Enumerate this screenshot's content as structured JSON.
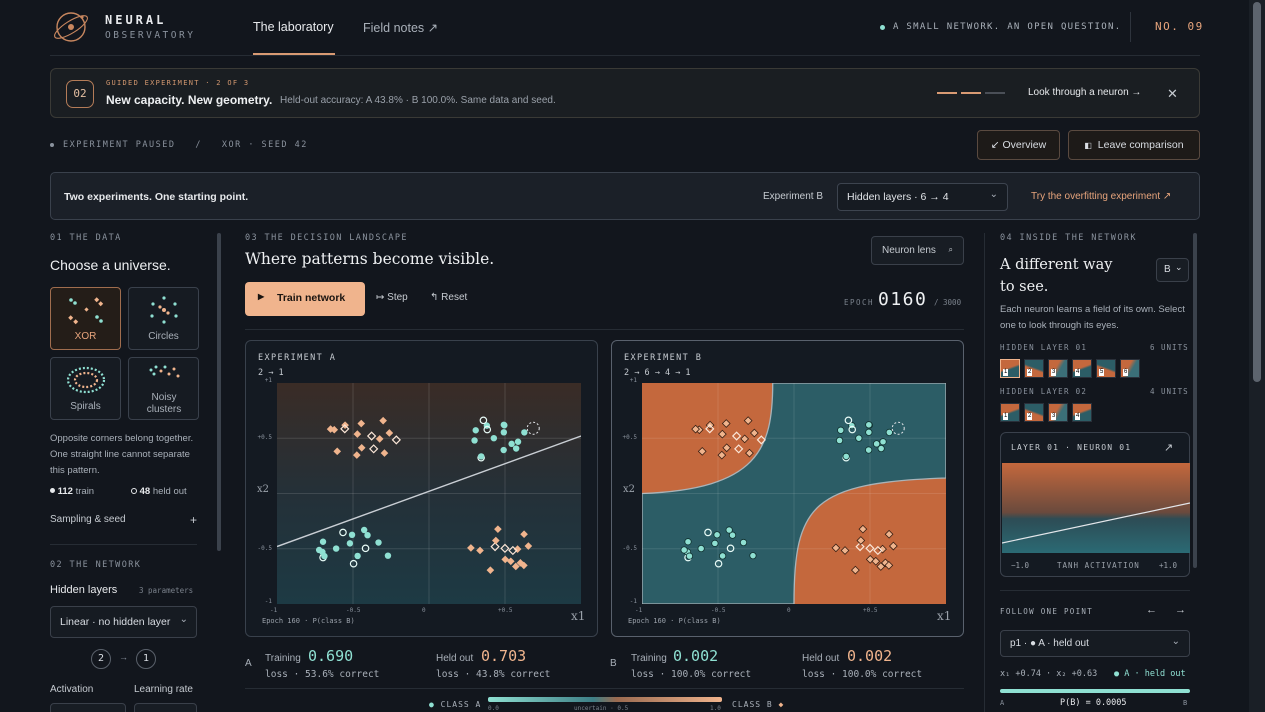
{
  "brand": {
    "line1": "NEURAL",
    "line2": "OBSERVATORY"
  },
  "nav": {
    "lab": "The laboratory",
    "notes": "Field notes",
    "notes_arrow": "↗"
  },
  "header": {
    "tagline": "A SMALL NETWORK. AN OPEN QUESTION.",
    "issue": "NO. 09"
  },
  "guide": {
    "num": "02",
    "kicker": "GUIDED EXPERIMENT · 2 OF 3",
    "title": "New capacity. New geometry.",
    "text": "Held-out accuracy: A 43.8% · B 100.0%. Same data and seed.",
    "link": "Look through a neuron →",
    "close": "✕"
  },
  "status": {
    "text": "EXPERIMENT PAUSED",
    "sep": "/",
    "dataset": "XOR · SEED 42",
    "overview": "↙ Overview",
    "leave": "Leave comparison"
  },
  "compare": {
    "title": "Two experiments. One starting point.",
    "exp_label": "Experiment B",
    "select": "Hidden layers · 6 → 4",
    "link": "Try the overfitting experiment ↗"
  },
  "left": {
    "sec1": "01 THE DATA",
    "heading": "Choose a universe.",
    "tiles": [
      "XOR",
      "Circles",
      "Spirals",
      "Noisy clusters"
    ],
    "desc": "Opposite corners belong together. One straight line cannot separate this pattern.",
    "train_n": "112",
    "train_l": "train",
    "held_n": "48",
    "held_l": "held out",
    "sampling": "Sampling & seed",
    "plus": "+",
    "sec2": "02 THE NETWORK",
    "hidden": "Hidden layers",
    "params": "3 parameters",
    "arch": "Linear · no hidden layer",
    "in": "2",
    "arr": "→",
    "out": "1",
    "activation": "Activation",
    "lr": "Learning rate"
  },
  "center": {
    "sec": "03 THE DECISION LANDSCAPE",
    "heading": "Where patterns become visible.",
    "lens": "Neuron lens",
    "train": "Train network",
    "step": "Step",
    "reset": "Reset",
    "epoch_label": "EPOCH",
    "epoch": "0160",
    "epoch_total": "/ 3000",
    "plotA": {
      "title": "EXPERIMENT A",
      "arch": "2 → 1",
      "footer": "Epoch 160 · P(class B)"
    },
    "plotB": {
      "title": "EXPERIMENT B",
      "arch": "2 → 6 → 4 → 1",
      "footer": "Epoch 160 · P(class B)"
    },
    "ticks": {
      "y": [
        "+1",
        "+0.5",
        "-0.5",
        "-1"
      ],
      "x": [
        "-1",
        "-0.5",
        "0",
        "+0.5"
      ],
      "xlab": "x1",
      "ylab": "x2"
    },
    "statsA": {
      "tag": "A",
      "train_l": "Training",
      "train": "0.690",
      "train_sub": "loss · 53.6% correct",
      "held_l": "Held out",
      "held": "0.703",
      "held_sub": "loss · 43.8% correct"
    },
    "statsB": {
      "tag": "B",
      "train_l": "Training",
      "train": "0.002",
      "train_sub": "loss · 100.0% correct",
      "held_l": "Held out",
      "held": "0.002",
      "held_sub": "loss · 100.0% correct"
    },
    "legend": {
      "a": "CLASS A",
      "b": "CLASS B",
      "l": "0.0",
      "m": "uncertain · 0.5",
      "r": "1.0"
    }
  },
  "right": {
    "sec": "04 INSIDE THE NETWORK",
    "heading": "A different way to see.",
    "exp": "B",
    "desc": "Each neuron learns a field of its own. Select one to look through its eyes.",
    "l1": "HIDDEN LAYER 01",
    "l1u": "6 UNITS",
    "l2": "HIDDEN LAYER 02",
    "l2u": "4 UNITS",
    "neuron": "LAYER 01 · NEURON 01",
    "act_l": "−1.0",
    "act_m": "TANH ACTIVATION",
    "act_r": "+1.0",
    "follow": "FOLLOW ONE POINT",
    "point": "p1 · ● A · held out",
    "coords": "x₁ +0.74 · x₂ +0.63",
    "cls": "● A · held out",
    "pa": "A",
    "pb": "B",
    "prob": "P(B) = 0.0005"
  },
  "colors": {
    "peach": "#f0b48d",
    "teal": "#8fe0d2",
    "orange": "#b5613a",
    "deepteal": "#2c5d66",
    "bg": "#12161d"
  }
}
